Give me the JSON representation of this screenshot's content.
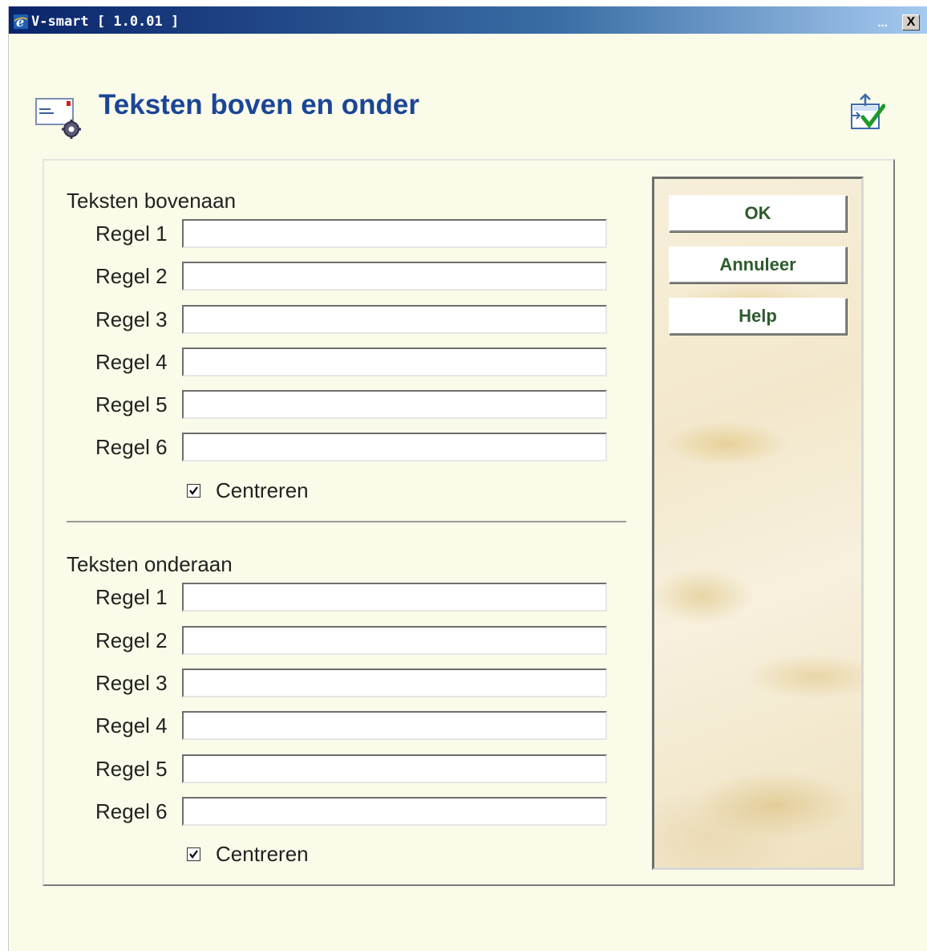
{
  "window": {
    "title": "V-smart [ 1.0.01 ]",
    "minimize_label": "...",
    "close_label": "X"
  },
  "header": {
    "title": "Teksten boven en onder",
    "page_icon": "envelope-gear-icon",
    "export_icon": "export-check-icon"
  },
  "top_section": {
    "title": "Teksten bovenaan",
    "rows": [
      {
        "label": "Regel 1",
        "value": ""
      },
      {
        "label": "Regel 2",
        "value": ""
      },
      {
        "label": "Regel 3",
        "value": ""
      },
      {
        "label": "Regel 4",
        "value": ""
      },
      {
        "label": "Regel 5",
        "value": ""
      },
      {
        "label": "Regel 6",
        "value": ""
      }
    ],
    "center_label": "Centreren",
    "center_checked": true
  },
  "bottom_section": {
    "title": "Teksten onderaan",
    "rows": [
      {
        "label": "Regel 1",
        "value": ""
      },
      {
        "label": "Regel 2",
        "value": ""
      },
      {
        "label": "Regel 3",
        "value": ""
      },
      {
        "label": "Regel 4",
        "value": ""
      },
      {
        "label": "Regel 5",
        "value": ""
      },
      {
        "label": "Regel 6",
        "value": ""
      }
    ],
    "center_label": "Centreren",
    "center_checked": true
  },
  "buttons": {
    "ok": "OK",
    "cancel": "Annuleer",
    "help": "Help"
  },
  "colors": {
    "title_color": "#1b4696",
    "button_text": "#2d5a2d",
    "background": "#fbfbe9"
  }
}
